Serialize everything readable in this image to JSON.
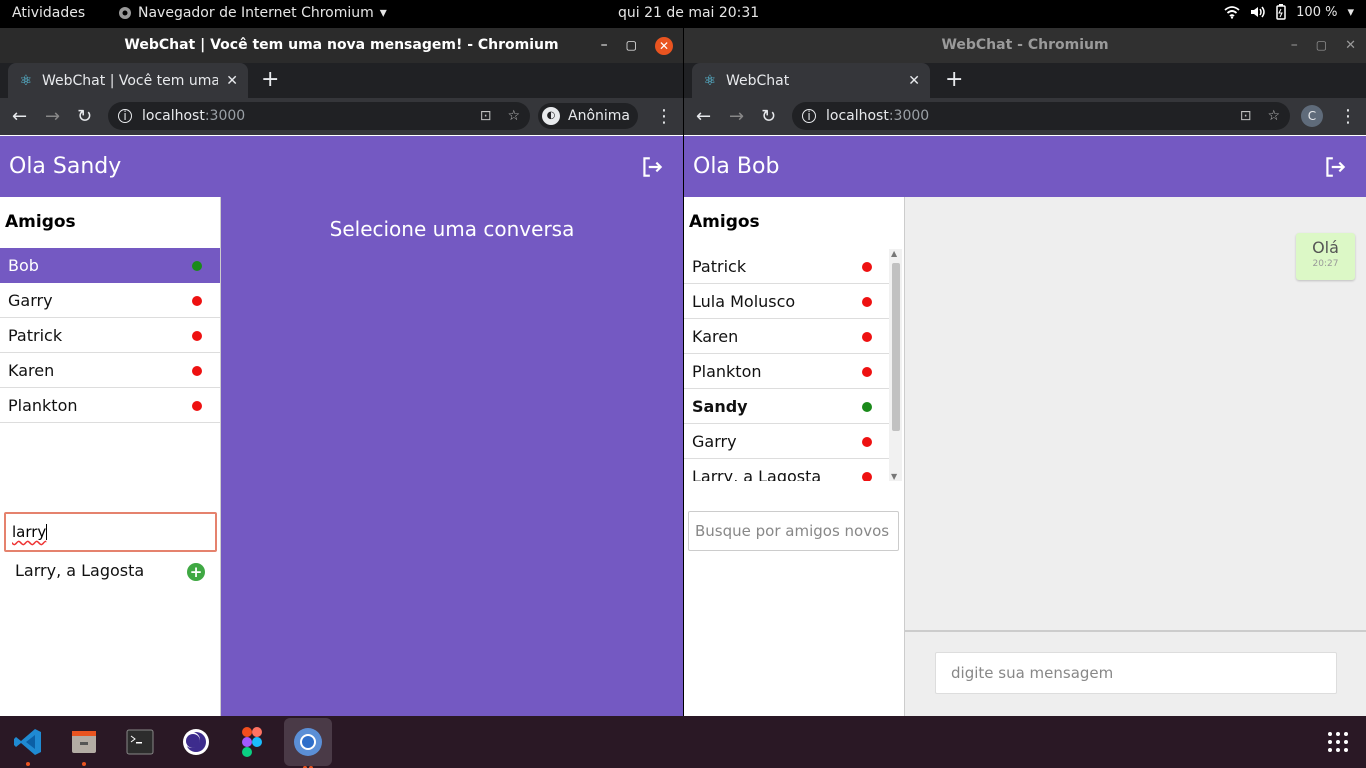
{
  "topbar": {
    "activities": "Atividades",
    "app_menu": "Navegador de Internet Chromium",
    "clock": "qui 21 de mai  20:31",
    "battery": "100 %"
  },
  "left_window": {
    "title": "WebChat | Você tem uma nova mensagem! - Chromium",
    "tab_title": "WebChat | Você tem uma nova mensagem!",
    "url_host": "localhost",
    "url_port": ":3000",
    "profile_label": "Anônima",
    "header_title": "Ola Sandy",
    "friends_title": "Amigos",
    "friends": [
      {
        "name": "Bob",
        "status": "online"
      },
      {
        "name": "Garry",
        "status": "offline"
      },
      {
        "name": "Patrick",
        "status": "offline"
      },
      {
        "name": "Karen",
        "status": "offline"
      },
      {
        "name": "Plankton",
        "status": "offline"
      }
    ],
    "search_value": "larry",
    "suggestion": "Larry, a Lagosta",
    "content_message": "Selecione uma conversa"
  },
  "right_window": {
    "title": "WebChat - Chromium",
    "tab_title": "WebChat",
    "url_host": "localhost",
    "url_port": ":3000",
    "profile_initial": "C",
    "header_title": "Ola Bob",
    "friends_title": "Amigos",
    "friends": [
      {
        "name": "Patrick",
        "status": "offline"
      },
      {
        "name": "Lula Molusco",
        "status": "offline"
      },
      {
        "name": "Karen",
        "status": "offline"
      },
      {
        "name": "Plankton",
        "status": "offline"
      },
      {
        "name": "Sandy",
        "status": "online"
      },
      {
        "name": "Garry",
        "status": "offline"
      },
      {
        "name": "Larry, a Lagosta",
        "status": "offline"
      }
    ],
    "search_placeholder": "Busque por amigos novos",
    "message": {
      "text": "Olá",
      "time": "20:27"
    },
    "composer_placeholder": "digite sua mensagem"
  },
  "colors": {
    "accent": "#7459c2",
    "online": "#1a8a1a",
    "offline": "#ee1111",
    "add": "#3fa843",
    "close_active": "#e95420"
  },
  "dock": [
    "vscode-icon",
    "files-icon",
    "terminal-icon",
    "eclipse-icon",
    "figma-icon",
    "chromium-icon",
    "app-grid-icon"
  ]
}
